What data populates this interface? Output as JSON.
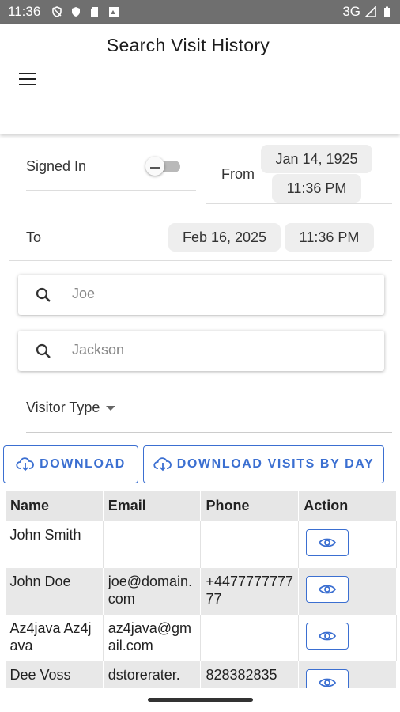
{
  "status_bar": {
    "time": "11:36",
    "network": "3G"
  },
  "app_bar": {
    "title": "Search Visit History"
  },
  "filters": {
    "signed_in_label": "Signed In",
    "from_label": "From",
    "from_date": "Jan 14, 1925",
    "from_time": "11:36 PM",
    "to_label": "To",
    "to_date": "Feb 16, 2025",
    "to_time": "11:36 PM",
    "first_name_value": "Joe",
    "last_name_value": "Jackson",
    "visitor_type_label": "Visitor Type"
  },
  "buttons": {
    "download": "DOWNLOAD",
    "download_by_day": "DOWNLOAD VISITS BY DAY"
  },
  "table": {
    "headers": [
      "Name",
      "Email",
      "Phone",
      "Action"
    ],
    "rows": [
      {
        "name": "John Smith",
        "email": "",
        "phone": ""
      },
      {
        "name": "John Doe",
        "email": "joe@domain.com",
        "phone": "+447777777777"
      },
      {
        "name": "Az4java Az4java",
        "email": "az4java@gmail.com",
        "phone": ""
      },
      {
        "name": "Dee Voss",
        "email": "dstorerater.",
        "phone": "828382835"
      }
    ]
  },
  "colors": {
    "accent": "#3b6fd1",
    "status_bar": "#6f6f6f"
  }
}
